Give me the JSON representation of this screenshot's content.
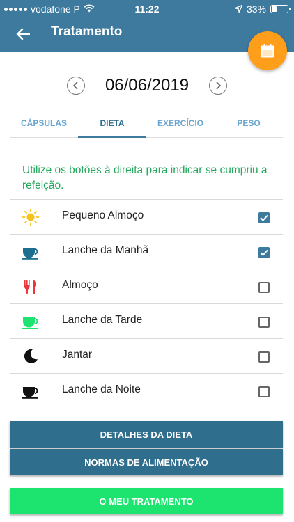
{
  "status_bar": {
    "carrier": "vodafone P",
    "time": "11:22",
    "battery": "33%",
    "battery_level": 0.33
  },
  "header": {
    "title": "Tratamento"
  },
  "date_nav": {
    "date": "06/06/2019"
  },
  "tabs": [
    {
      "label": "CÁPSULAS"
    },
    {
      "label": "DIETA"
    },
    {
      "label": "EXERCÍCIO"
    },
    {
      "label": "PESO"
    }
  ],
  "active_tab": "DIETA",
  "instruction": "Utilize os botões à direita para indicar se cumpriu a refeição.",
  "meals": [
    {
      "label": "Pequeno Almoço",
      "icon": "sun-icon",
      "checked": true
    },
    {
      "label": "Lanche da Manhã",
      "icon": "cup-icon",
      "checked": true
    },
    {
      "label": "Almoço",
      "icon": "cutlery-icon",
      "checked": false
    },
    {
      "label": "Lanche da Tarde",
      "icon": "cup-icon",
      "checked": false
    },
    {
      "label": "Jantar",
      "icon": "moon-icon",
      "checked": false
    },
    {
      "label": "Lanche da Noite",
      "icon": "cup-icon",
      "checked": false
    }
  ],
  "buttons": {
    "diet_details": "DETALHES DA DIETA",
    "feeding_rules": "NORMAS DE ALIMENTAÇÃO",
    "my_treatment": "O MEU TRATAMENTO"
  },
  "colors": {
    "primary": "#3d7a9e",
    "accent": "#ff9e1b",
    "success": "#1de46e",
    "instruction_text": "#23a85c"
  }
}
